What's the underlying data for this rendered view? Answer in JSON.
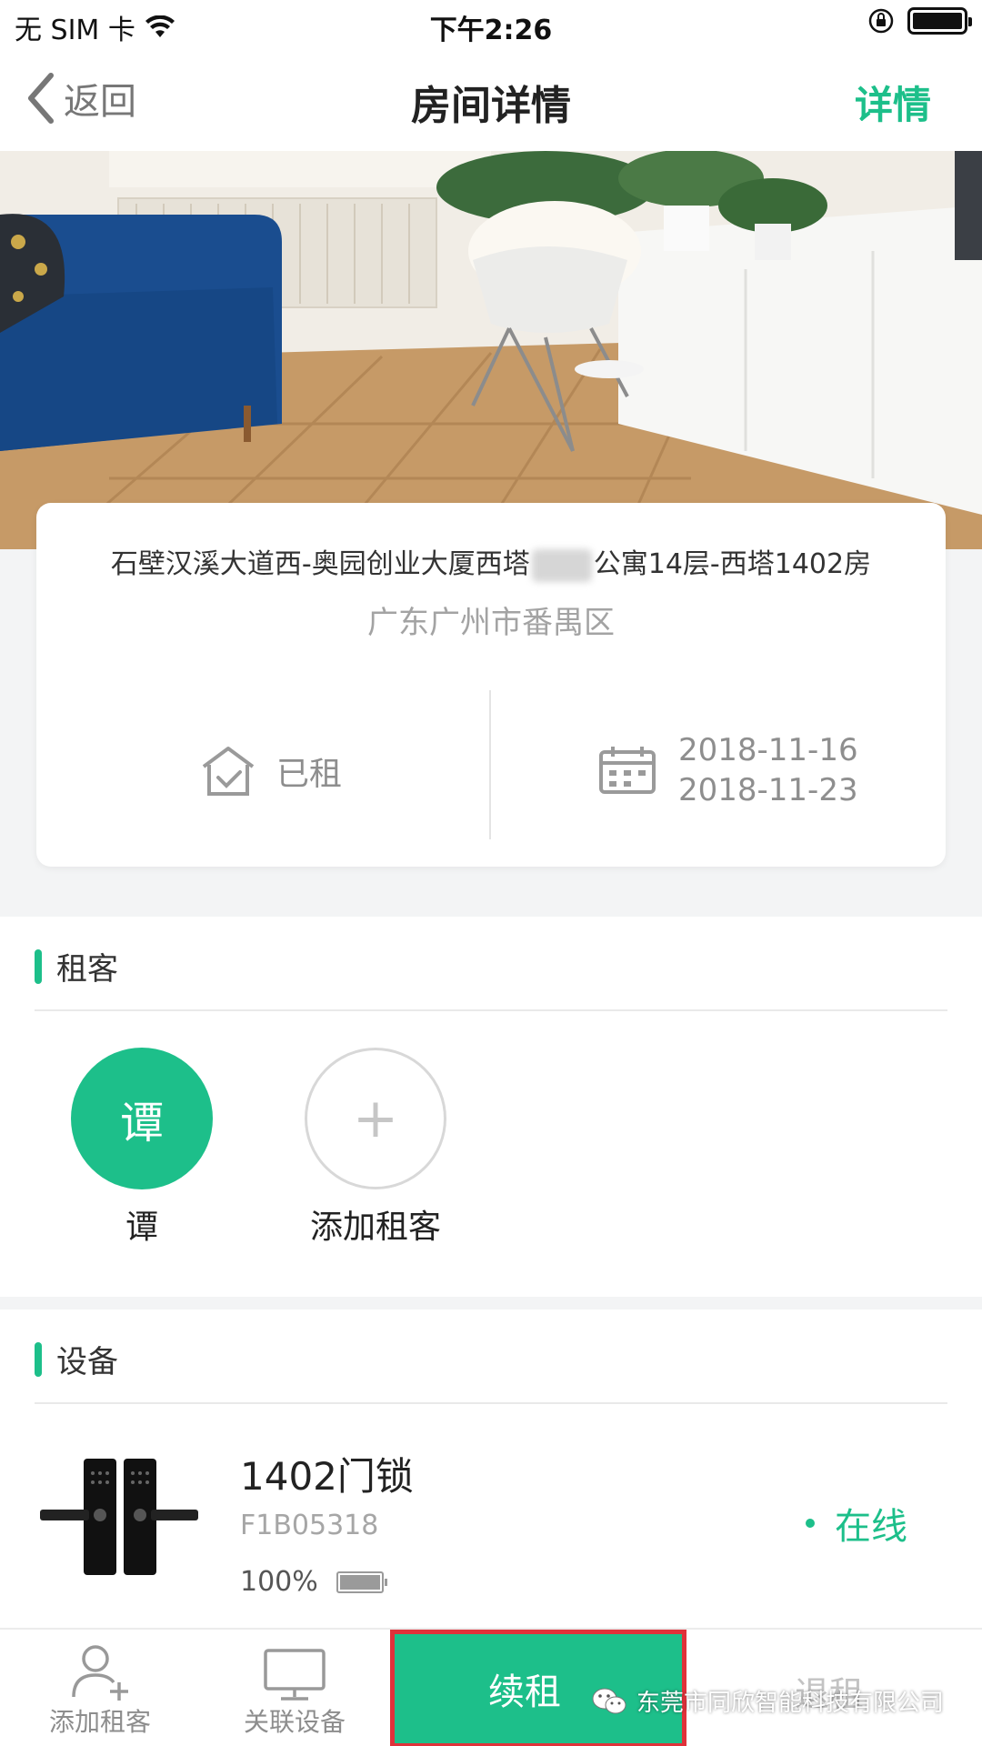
{
  "status_bar": {
    "carrier": "无 SIM 卡",
    "time": "下午2:26"
  },
  "nav": {
    "back_label": "返回",
    "title": "房间详情",
    "detail_label": "详情"
  },
  "room": {
    "address_before": "石壁汉溪大道西-奥园创业大厦西塔",
    "address_after": "公寓14层-西塔1402房",
    "district": "广东广州市番禺区",
    "status": "已租",
    "start_date": "2018-11-16",
    "end_date": "2018-11-23"
  },
  "tenants": {
    "section_title": "租客",
    "items": [
      {
        "avatar_char": "谭",
        "name": "谭"
      }
    ],
    "add_symbol": "+",
    "add_label": "添加租客"
  },
  "devices": {
    "section_title": "设备",
    "items": [
      {
        "name": "1402门锁",
        "id": "F1B05318",
        "battery": "100%",
        "battery_level": 1.0,
        "status": "在线"
      }
    ]
  },
  "tab_bar": {
    "add_tenant": "添加租客",
    "link_device": "关联设备",
    "renew": "续租",
    "checkout": "退租"
  },
  "watermark": {
    "text": "东莞市同欣智能科技有限公司"
  },
  "colors": {
    "accent": "#1dbf8a",
    "highlight_border": "#e0323a"
  },
  "icons": [
    "wifi-icon",
    "orientation-lock-icon",
    "battery-icon",
    "back-chevron-icon",
    "house-check-icon",
    "calendar-icon",
    "plus-icon",
    "user-add-icon",
    "monitor-icon",
    "wechat-icon"
  ]
}
